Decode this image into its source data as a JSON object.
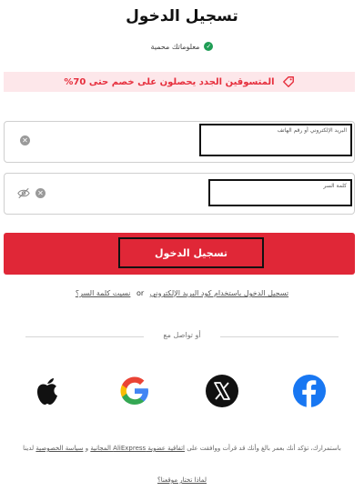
{
  "header": {
    "title": "تسجيل الدخول"
  },
  "security": {
    "text": "معلوماتك محمية"
  },
  "promo": {
    "text": "المتسوقين الجدد يحصلون على خصم حتى 70%"
  },
  "email_field": {
    "placeholder": "البريد الإلكتروني أو رقم الهاتف",
    "value": ""
  },
  "password_field": {
    "placeholder": "كلمة السر",
    "value": ""
  },
  "signin_button": {
    "label": "تسجيل الدخول"
  },
  "links": {
    "forgot": "نسيت كلمة السر؟",
    "or": "or",
    "code_login": "تسجيل الدخول باستخدام كود البريد الإلكتروني"
  },
  "divider": {
    "text": "أو تواصل مع"
  },
  "social": {
    "facebook": "facebook-icon",
    "x": "x-icon",
    "google": "google-icon",
    "apple": "apple-icon"
  },
  "terms": {
    "prefix": "باستمرارك، تؤكد أنك بعمر بالغ وأنك قد قرأت ووافقت على",
    "agreement_link": "اتفاقية عضوية AliExpress المجانية",
    "and": "و",
    "privacy_link": "سياسة الخصوصية",
    "suffix": "لدينا",
    "optout_link": "لماذا تختار موقعنا؟"
  },
  "colors": {
    "brand_red": "#e02737",
    "promo_bg": "#fde7ea",
    "secure_green": "#1f9d55"
  }
}
